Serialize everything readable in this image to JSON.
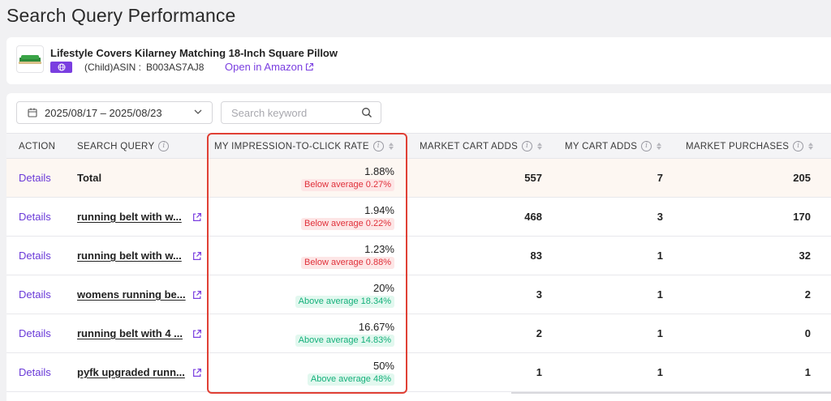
{
  "page": {
    "title": "Search Query Performance"
  },
  "product": {
    "name": "Lifestyle Covers Kilarney Matching 18-Inch Square Pillow",
    "asin_label": "(Child)ASIN :",
    "asin": "B003AS7AJ8",
    "amazon_link": "Open in Amazon"
  },
  "filters": {
    "date_range": "2025/08/17 – 2025/08/23",
    "search_placeholder": "Search keyword"
  },
  "table": {
    "columns": {
      "action": "ACTION",
      "search_query": "SEARCH QUERY",
      "impression_rate": "MY IMPRESSION-TO-CLICK RATE",
      "market_cart_adds": "MARKET CART ADDS",
      "my_cart_adds": "MY CART ADDS",
      "market_purchases": "MARKET PURCHASES"
    },
    "rows": [
      {
        "action": "Details",
        "query": "Total",
        "rate": "1.88%",
        "badge": "Below average 0.27%",
        "badge_type": "below",
        "market_cart_adds": "557",
        "my_cart_adds": "7",
        "market_purchases": "205"
      },
      {
        "action": "Details",
        "query": "running belt with w...",
        "rate": "1.94%",
        "badge": "Below average 0.22%",
        "badge_type": "below",
        "market_cart_adds": "468",
        "my_cart_adds": "3",
        "market_purchases": "170"
      },
      {
        "action": "Details",
        "query": "running belt with w...",
        "rate": "1.23%",
        "badge": "Below average 0.88%",
        "badge_type": "below",
        "market_cart_adds": "83",
        "my_cart_adds": "1",
        "market_purchases": "32"
      },
      {
        "action": "Details",
        "query": "womens running be...",
        "rate": "20%",
        "badge": "Above average 18.34%",
        "badge_type": "above",
        "market_cart_adds": "3",
        "my_cart_adds": "1",
        "market_purchases": "2"
      },
      {
        "action": "Details",
        "query": "running belt with 4 ...",
        "rate": "16.67%",
        "badge": "Above average 14.83%",
        "badge_type": "above",
        "market_cart_adds": "2",
        "my_cart_adds": "1",
        "market_purchases": "0"
      },
      {
        "action": "Details",
        "query": "pyfk upgraded runn...",
        "rate": "50%",
        "badge": "Above average 48%",
        "badge_type": "above",
        "market_cart_adds": "1",
        "my_cart_adds": "1",
        "market_purchases": "1"
      }
    ]
  },
  "colors": {
    "accent": "#7a3ee0",
    "highlight": "#e04035",
    "below": "#e0303a",
    "above": "#14b07a"
  }
}
